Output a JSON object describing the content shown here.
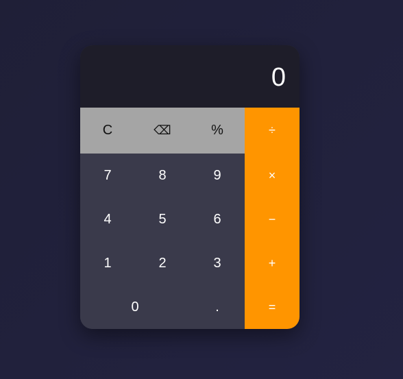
{
  "display": {
    "value": "0"
  },
  "keys": {
    "clear": "C",
    "backspace": "⌫",
    "percent": "%",
    "divide": "÷",
    "seven": "7",
    "eight": "8",
    "nine": "9",
    "multiply": "×",
    "four": "4",
    "five": "5",
    "six": "6",
    "subtract": "−",
    "one": "1",
    "two": "2",
    "three": "3",
    "add": "+",
    "zero": "0",
    "decimal": ".",
    "equals": "="
  },
  "colors": {
    "background": "#22223a",
    "display": "#1e1d29",
    "number_keys": "#3a3a4b",
    "function_keys": "#a5a5a5",
    "operator_keys": "#ff9500"
  }
}
